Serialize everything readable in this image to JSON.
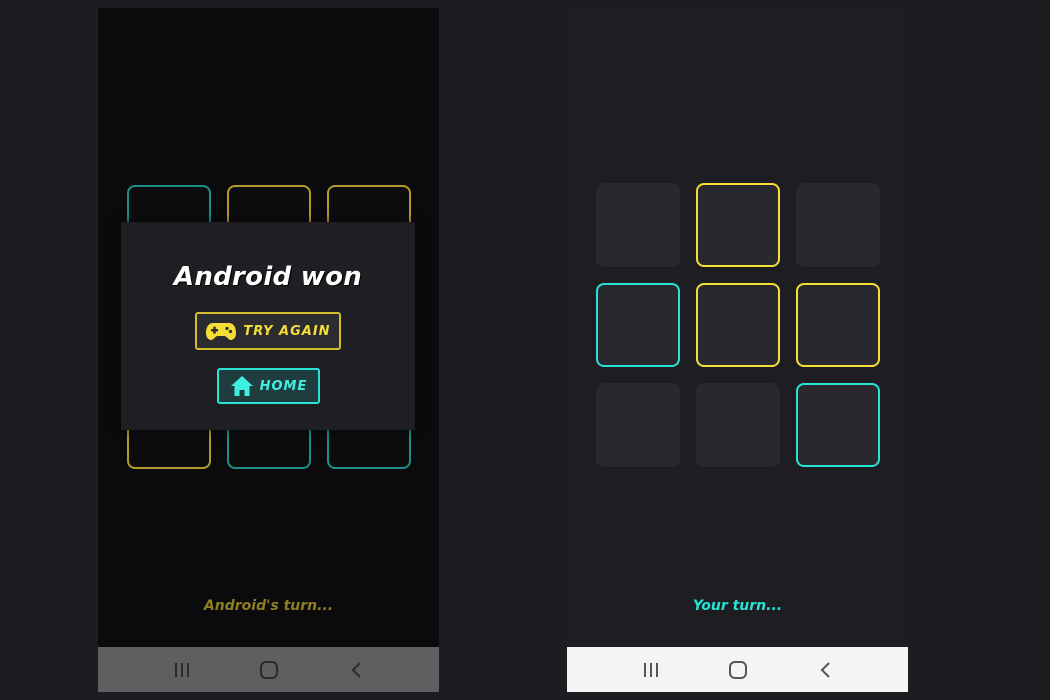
{
  "left_screen": {
    "board": [
      [
        "c",
        "y",
        "y"
      ],
      [
        "",
        "",
        ""
      ],
      [
        "y",
        "c",
        "c"
      ]
    ],
    "dialog": {
      "title": "Android won",
      "try_again_label": "TRY AGAIN",
      "try_again_icon": "gamepad-icon",
      "home_label": "HOME",
      "home_icon": "home-icon"
    },
    "status_text": "Android's turn...",
    "status_color": "#8e7f22"
  },
  "right_screen": {
    "board": [
      [
        "",
        "y",
        ""
      ],
      [
        "c",
        "y",
        "y"
      ],
      [
        "",
        "",
        "c"
      ]
    ],
    "status_text": "Your turn...",
    "status_color": "#27e3d6"
  },
  "colors": {
    "player_yellow": "#f5de37",
    "player_cyan": "#27e3d6",
    "background": "#1d1c21"
  },
  "navbar": {
    "icons": [
      "recent-apps-icon",
      "home-circle-icon",
      "back-icon"
    ]
  }
}
